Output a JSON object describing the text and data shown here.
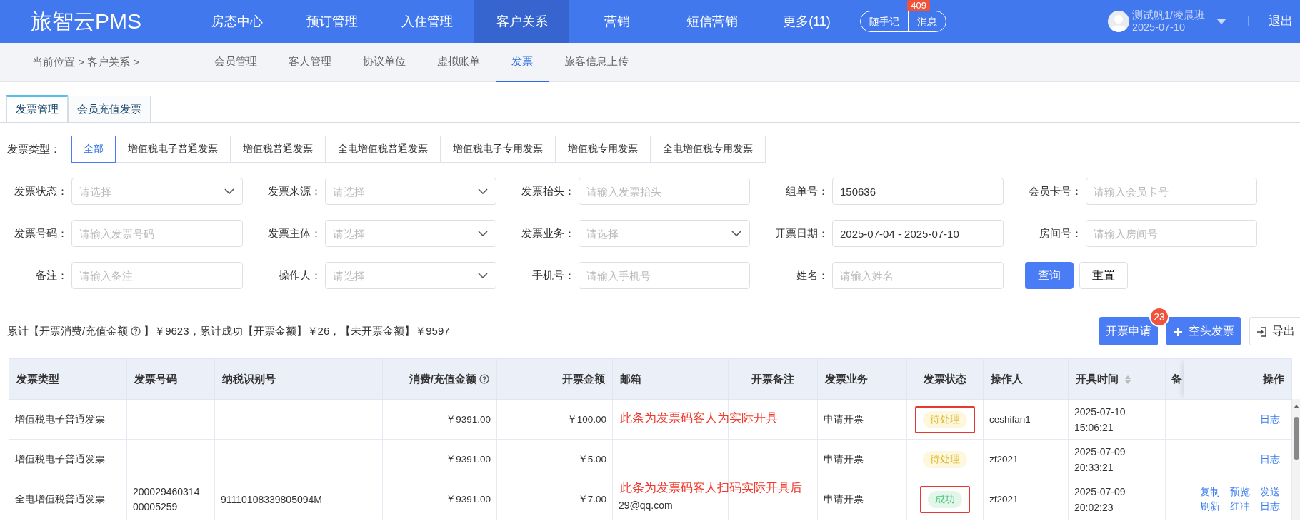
{
  "app": {
    "logo": "旅智云PMS",
    "nav": [
      {
        "label": "房态中心",
        "selected": false
      },
      {
        "label": "预订管理",
        "selected": false
      },
      {
        "label": "入住管理",
        "selected": false
      },
      {
        "label": "客户关系",
        "selected": true
      },
      {
        "label": "营销",
        "selected": false
      },
      {
        "label": "短信营销",
        "selected": false
      },
      {
        "label": "更多(11)",
        "selected": false
      }
    ],
    "notes_button": "随手记",
    "messages_button": "消息",
    "messages_badge": "409",
    "user": {
      "name": "测试帆1/凌晨班",
      "date": "2025-07-10"
    },
    "logout": "退出"
  },
  "breadcrumb": "当前位置 > 客户关系 >",
  "subnav": [
    {
      "label": "会员管理",
      "selected": false
    },
    {
      "label": "客人管理",
      "selected": false
    },
    {
      "label": "协议单位",
      "selected": false
    },
    {
      "label": "虚拟账单",
      "selected": false
    },
    {
      "label": "发票",
      "selected": true
    },
    {
      "label": "旅客信息上传",
      "selected": false
    }
  ],
  "tabs": [
    {
      "label": "发票管理",
      "selected": true
    },
    {
      "label": "会员充值发票",
      "selected": false
    }
  ],
  "invoice_type": {
    "label": "发票类型：",
    "options": [
      {
        "label": "全部",
        "selected": true
      },
      {
        "label": "增值税电子普通发票",
        "selected": false
      },
      {
        "label": "增值税普通发票",
        "selected": false
      },
      {
        "label": "全电增值税普通发票",
        "selected": false
      },
      {
        "label": "增值税电子专用发票",
        "selected": false
      },
      {
        "label": "增值税专用发票",
        "selected": false
      },
      {
        "label": "全电增值税专用发票",
        "selected": false
      }
    ]
  },
  "filters": [
    {
      "label": "发票状态：",
      "kind": "select",
      "placeholder": "请选择"
    },
    {
      "label": "发票来源：",
      "kind": "select",
      "placeholder": "请选择"
    },
    {
      "label": "发票抬头：",
      "kind": "input",
      "placeholder": "请输入发票抬头"
    },
    {
      "label": "组单号：",
      "kind": "input",
      "value": "150636"
    },
    {
      "label": "会员卡号：",
      "kind": "input",
      "placeholder": "请输入会员卡号"
    },
    {
      "label": "发票号码：",
      "kind": "input",
      "placeholder": "请输入发票号码"
    },
    {
      "label": "发票主体：",
      "kind": "select",
      "placeholder": "请选择"
    },
    {
      "label": "发票业务：",
      "kind": "select",
      "placeholder": "请选择"
    },
    {
      "label": "开票日期：",
      "kind": "input",
      "value": "2025-07-04 - 2025-07-10"
    },
    {
      "label": "房间号：",
      "kind": "input",
      "placeholder": "请输入房间号"
    },
    {
      "label": "备注：",
      "kind": "input",
      "placeholder": "请输入备注"
    },
    {
      "label": "操作人：",
      "kind": "select",
      "placeholder": "请选择"
    },
    {
      "label": "手机号：",
      "kind": "input",
      "placeholder": "请输入手机号"
    },
    {
      "label": "姓名：",
      "kind": "input",
      "placeholder": "请输入姓名"
    }
  ],
  "search_button": "查询",
  "reset_button": "重置",
  "summary": {
    "before": "累计【开票消费/充值金额",
    "after": "】￥9623，累计成功【开票金额】￥26，【未开票金额】￥9597"
  },
  "actions": {
    "apply": "开票申请",
    "apply_badge": "23",
    "blank": "空头发票",
    "export": "导出"
  },
  "table": {
    "columns": [
      {
        "label": "发票类型"
      },
      {
        "label": "发票号码"
      },
      {
        "label": "纳税识别号"
      },
      {
        "label": "消费/充值金额",
        "help": true
      },
      {
        "label": "开票金额"
      },
      {
        "label": "邮箱"
      },
      {
        "label": "开票备注"
      },
      {
        "label": "发票业务"
      },
      {
        "label": "发票状态"
      },
      {
        "label": "操作人"
      },
      {
        "label": "开具时间",
        "sortable": true
      },
      {
        "label": "备"
      },
      {
        "label": "操作"
      }
    ],
    "rows": [
      {
        "type": "增值税电子普通发票",
        "amount": "￥9391.00",
        "invoice_amount": "￥100.00",
        "note": "此条为发票码客人为实际开具",
        "business": "申请开票",
        "status": {
          "text": "待处理",
          "kind": "pending",
          "flagged": true
        },
        "operator": "ceshifan1",
        "time": "2025-07-10 15:06:21",
        "actions": [
          "日志"
        ]
      },
      {
        "type": "增值税电子普通发票",
        "amount": "￥9391.00",
        "invoice_amount": "￥5.00",
        "business": "申请开票",
        "status": {
          "text": "待处理",
          "kind": "pending",
          "flagged": false
        },
        "operator": "zf2021",
        "time": "2025-07-09 20:33:21",
        "actions": [
          "日志"
        ]
      },
      {
        "type": "全电增值税普通发票",
        "number": "20002946031400005259",
        "tax_id": "91110108339805094M",
        "amount": "￥9391.00",
        "invoice_amount": "￥7.00",
        "email": "29@qq.com",
        "note": "此条为发票码客人扫码实际开具后",
        "business": "申请开票",
        "status": {
          "text": "成功",
          "kind": "success",
          "flagged": true
        },
        "operator": "zf2021",
        "time": "2025-07-09 20:02:23",
        "actions": [
          "复制",
          "预览",
          "发送",
          "刷新",
          "红冲",
          "日志"
        ]
      }
    ]
  }
}
